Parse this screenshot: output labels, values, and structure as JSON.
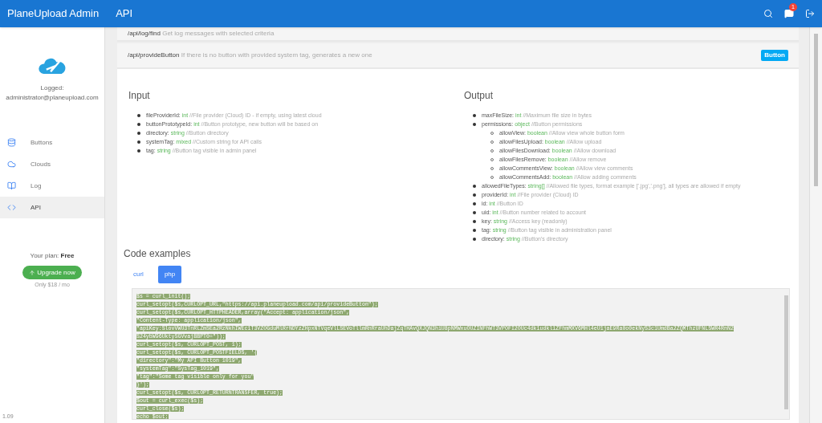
{
  "header": {
    "title": "PlaneUpload Admin",
    "section": "API",
    "notification_count": "1"
  },
  "sidebar": {
    "logged_label": "Logged:",
    "user": "administrator@planeupload.com",
    "items": [
      {
        "label": "Buttons",
        "selected": false
      },
      {
        "label": "Clouds",
        "selected": false
      },
      {
        "label": "Log",
        "selected": false
      },
      {
        "label": "API",
        "selected": true
      }
    ],
    "plan_label": "Your plan:",
    "plan": "Free",
    "upgrade_button": "Upgrade now",
    "price": "Only $18 / mo",
    "version": "1.09"
  },
  "endpoints": [
    {
      "path": "/api/log/find",
      "description": "Get log messages with selected criteria"
    },
    {
      "path": "/api/provideButton",
      "description": "If there is no button with provided system tag, generates a new one",
      "badge": "Button"
    }
  ],
  "input": {
    "title": "Input",
    "fields": [
      {
        "name": "fileProviderId:",
        "type": "int",
        "comment": "//File provider (Cloud) ID - if empty, using latest cloud"
      },
      {
        "name": "buttonPrototypeId:",
        "type": "int",
        "comment": "//Button prototype, new button will be based on"
      },
      {
        "name": "directory:",
        "type": "string",
        "comment": "//Button directory"
      },
      {
        "name": "systemTag:",
        "type": "mixed",
        "comment": "//Custom string for API calls"
      },
      {
        "name": "tag:",
        "type": "string",
        "comment": "//Button tag visible in admin panel"
      }
    ]
  },
  "output": {
    "title": "Output",
    "fields": [
      {
        "name": "maxFileSize:",
        "type": "int",
        "comment": "//Maximum file size in bytes"
      },
      {
        "name": "permissions:",
        "type": "object",
        "comment": "//Button permissions",
        "children": [
          {
            "name": "allowView:",
            "type": "boolean",
            "comment": "//Allow view whole button form"
          },
          {
            "name": "allowFilesUpload:",
            "type": "boolean",
            "comment": "//Allow upload"
          },
          {
            "name": "allowFilesDownload:",
            "type": "boolean",
            "comment": "//Allow download"
          },
          {
            "name": "allowFilesRemove:",
            "type": "boolean",
            "comment": "//Allow remove"
          },
          {
            "name": "allowCommentsView:",
            "type": "boolean",
            "comment": "//Allow view comments"
          },
          {
            "name": "allowCommentsAdd:",
            "type": "boolean",
            "comment": "//Allow adding comments"
          }
        ]
      },
      {
        "name": "allowedFileTypes:",
        "type": "string[]",
        "comment": "//Allowed file types, format example ['.jpg','.png'], all types are allowed if empty"
      },
      {
        "name": "providerId:",
        "type": "int",
        "comment": "//File provider (Cloud) ID"
      },
      {
        "name": "id:",
        "type": "int",
        "comment": "//Button ID"
      },
      {
        "name": "uid:",
        "type": "int",
        "comment": "//Button number related to account"
      },
      {
        "name": "key:",
        "type": "string",
        "comment": "//Access key (readonly)"
      },
      {
        "name": "tag:",
        "type": "string",
        "comment": "//Button tag visible in administration panel"
      },
      {
        "name": "directory:",
        "type": "string",
        "comment": "//Button's directory"
      }
    ]
  },
  "code_examples": {
    "title": "Code examples",
    "tabs": [
      {
        "label": "curl",
        "selected": false
      },
      {
        "label": "php",
        "selected": true
      }
    ],
    "lines": [
      "$s = curl_init();",
      "curl_setopt($s,CURLOPT_URL,\"https://api.planeupload.com/api/provideButton\");",
      "curl_setopt($s,CURLOPT_HTTPHEADER,array(\"Accept: application/json\",",
      "\"Content-Type: application/json\",",
      "\"apiKey:SlovVWU3TnRLZmSEa2RzNkhIWEc1T3VZOGduMlRrNDYzZHpxNTVqeVlLSEVoTllmRnRraUhDajZqTHAvQXJQN3hiU8pNMWxuOUZINFhWT3VPOFI2OUc4dk1udkl1ZFhmMXV6MHl4eU1jaE9Ra0o0ekNyS3c1UmdBa2ZQMThzUFNLSWR4RnN2",
      "S24ybW96UktySGVvajBBPT0=\"));",
      "curl_setopt($s, CURLOPT_POST, 1);",
      "curl_setopt($s, CURLOPT_POSTFIELDS, '{",
      "\"directory\":\"My API Button 1019\",",
      "\"systemTag\":\"SysTag_1019\",",
      "\"tag\":\"Some tag visible only for you\"",
      "}');",
      "curl_setopt($s, CURLOPT_RETURNTRANSFER, true);",
      "$out = curl_exec($s);",
      "curl_close($s);",
      "echo $out;"
    ]
  }
}
